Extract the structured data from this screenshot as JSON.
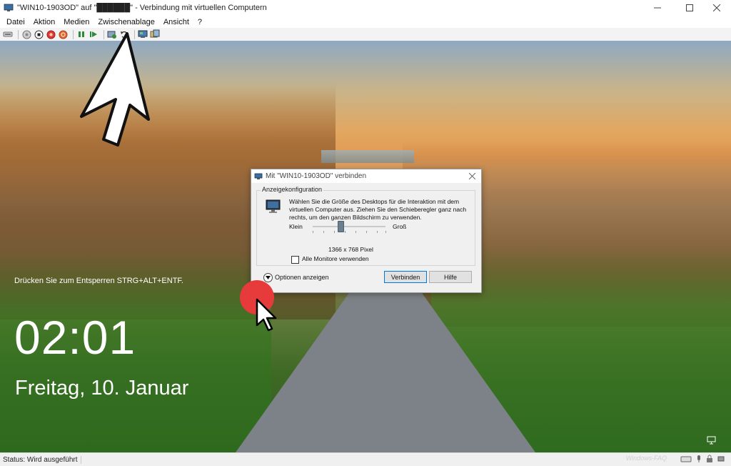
{
  "window": {
    "title": "\"WIN10-1903OD\" auf \"██████\" - Verbindung mit virtuellen Computern",
    "minimize_icon": "minimize-icon",
    "maximize_icon": "maximize-icon",
    "close_icon": "close-icon"
  },
  "menu": {
    "items": [
      "Datei",
      "Aktion",
      "Medien",
      "Zwischenablage",
      "Ansicht",
      "?"
    ]
  },
  "toolbar": {
    "icons": [
      "ctrl-alt-del-icon",
      "start-icon",
      "stop-icon",
      "shutdown-icon",
      "save-icon",
      "pause-icon",
      "resume-icon",
      "checkpoint-icon",
      "revert-icon",
      "enhanced-session-icon",
      "share-icon"
    ],
    "colors": {
      "stop": "#e23a2e",
      "shutdown": "#e8682b",
      "pause": "#2e8b3a",
      "resume": "#2e8b3a"
    }
  },
  "lockscreen": {
    "hint": "Drücken Sie zum Entsperren STRG+ALT+ENTF.",
    "time": "02:01",
    "date": "Freitag, 10. Januar"
  },
  "dialog": {
    "title": "Mit \"WIN10-1903OD\" verbinden",
    "group_label": "Anzeigekonfiguration",
    "description": "Wählen Sie die Größe des Desktops für die Interaktion mit dem virtuellen Computer aus. Ziehen Sie den Schieberegler ganz nach rechts, um den ganzen Bildschirm zu verwenden.",
    "slider_min_label": "Klein",
    "slider_max_label": "Groß",
    "slider_level": 0.38,
    "resolution": "1366 x 768 Pixel",
    "all_monitors_label": "Alle Monitore verwenden",
    "all_monitors_checked": false,
    "options_label": "Optionen anzeigen",
    "connect_label": "Verbinden",
    "help_label": "Hilfe"
  },
  "status": {
    "text": "Status: Wird ausgeführt",
    "watermark": "Windows-FAQ"
  },
  "annotations": {
    "arrow_color": "#ffffff",
    "marker_color": "#e73b3b"
  }
}
